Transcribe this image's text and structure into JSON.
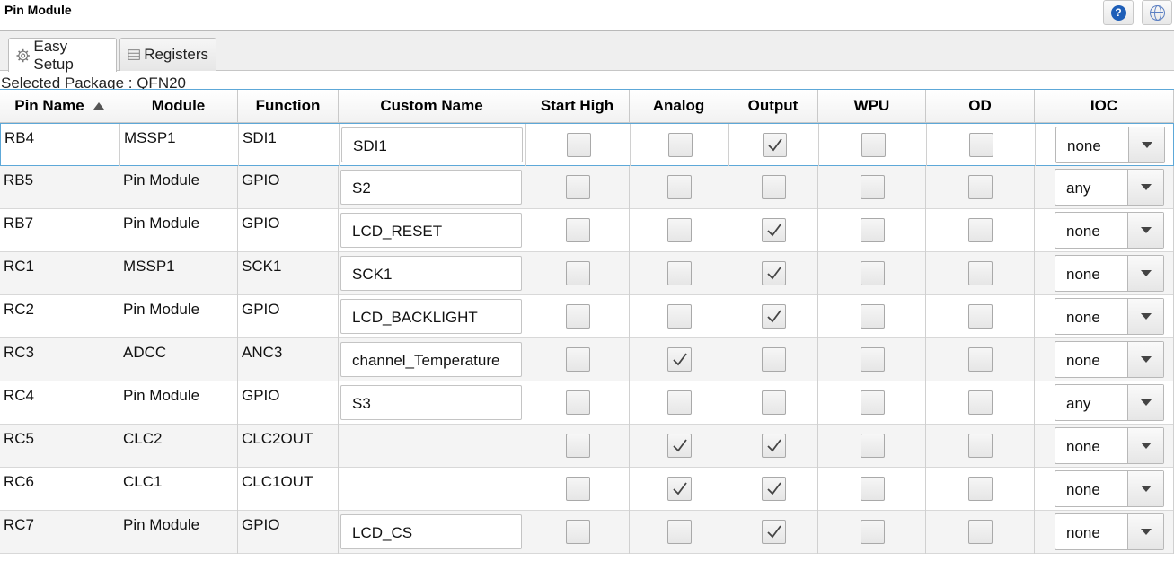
{
  "window": {
    "title": "Pin Module"
  },
  "tabs": [
    {
      "label": "Easy Setup",
      "icon": "gear-icon",
      "active": true
    },
    {
      "label": "Registers",
      "icon": "list-icon",
      "active": false
    }
  ],
  "selected_package": "Selected Package : QFN20",
  "columns": [
    "Pin Name",
    "Module",
    "Function",
    "Custom Name",
    "Start High",
    "Analog",
    "Output",
    "WPU",
    "OD",
    "IOC"
  ],
  "sort": {
    "column": "Pin Name",
    "direction": "ascending"
  },
  "rows": [
    {
      "pin": "RB4",
      "module": "MSSP1",
      "function": "SDI1",
      "custom_name": "SDI1",
      "start_high": false,
      "analog": false,
      "output": true,
      "wpu": false,
      "od": false,
      "ioc": "none"
    },
    {
      "pin": "RB5",
      "module": "Pin Module",
      "function": "GPIO",
      "custom_name": "S2",
      "start_high": false,
      "analog": false,
      "output": false,
      "wpu": false,
      "od": false,
      "ioc": "any"
    },
    {
      "pin": "RB7",
      "module": "Pin Module",
      "function": "GPIO",
      "custom_name": "LCD_RESET",
      "start_high": false,
      "analog": false,
      "output": true,
      "wpu": false,
      "od": false,
      "ioc": "none"
    },
    {
      "pin": "RC1",
      "module": "MSSP1",
      "function": "SCK1",
      "custom_name": "SCK1",
      "start_high": false,
      "analog": false,
      "output": true,
      "wpu": false,
      "od": false,
      "ioc": "none"
    },
    {
      "pin": "RC2",
      "module": "Pin Module",
      "function": "GPIO",
      "custom_name": "LCD_BACKLIGHT",
      "start_high": false,
      "analog": false,
      "output": true,
      "wpu": false,
      "od": false,
      "ioc": "none"
    },
    {
      "pin": "RC3",
      "module": "ADCC",
      "function": "ANC3",
      "custom_name": "channel_Temperature",
      "start_high": false,
      "analog": true,
      "output": false,
      "wpu": false,
      "od": false,
      "ioc": "none"
    },
    {
      "pin": "RC4",
      "module": "Pin Module",
      "function": "GPIO",
      "custom_name": "S3",
      "start_high": false,
      "analog": false,
      "output": false,
      "wpu": false,
      "od": false,
      "ioc": "any"
    },
    {
      "pin": "RC5",
      "module": "CLC2",
      "function": "CLC2OUT",
      "custom_name": "",
      "start_high": false,
      "analog": true,
      "output": true,
      "wpu": false,
      "od": false,
      "ioc": "none"
    },
    {
      "pin": "RC6",
      "module": "CLC1",
      "function": "CLC1OUT",
      "custom_name": "",
      "start_high": false,
      "analog": true,
      "output": true,
      "wpu": false,
      "od": false,
      "ioc": "none"
    },
    {
      "pin": "RC7",
      "module": "Pin Module",
      "function": "GPIO",
      "custom_name": "LCD_CS",
      "start_high": false,
      "analog": false,
      "output": true,
      "wpu": false,
      "od": false,
      "ioc": "none"
    }
  ],
  "colors": {
    "selection_border": "#5da8d8",
    "alt_row": "#f4f4f4",
    "help_icon": "#1f5fb8"
  }
}
